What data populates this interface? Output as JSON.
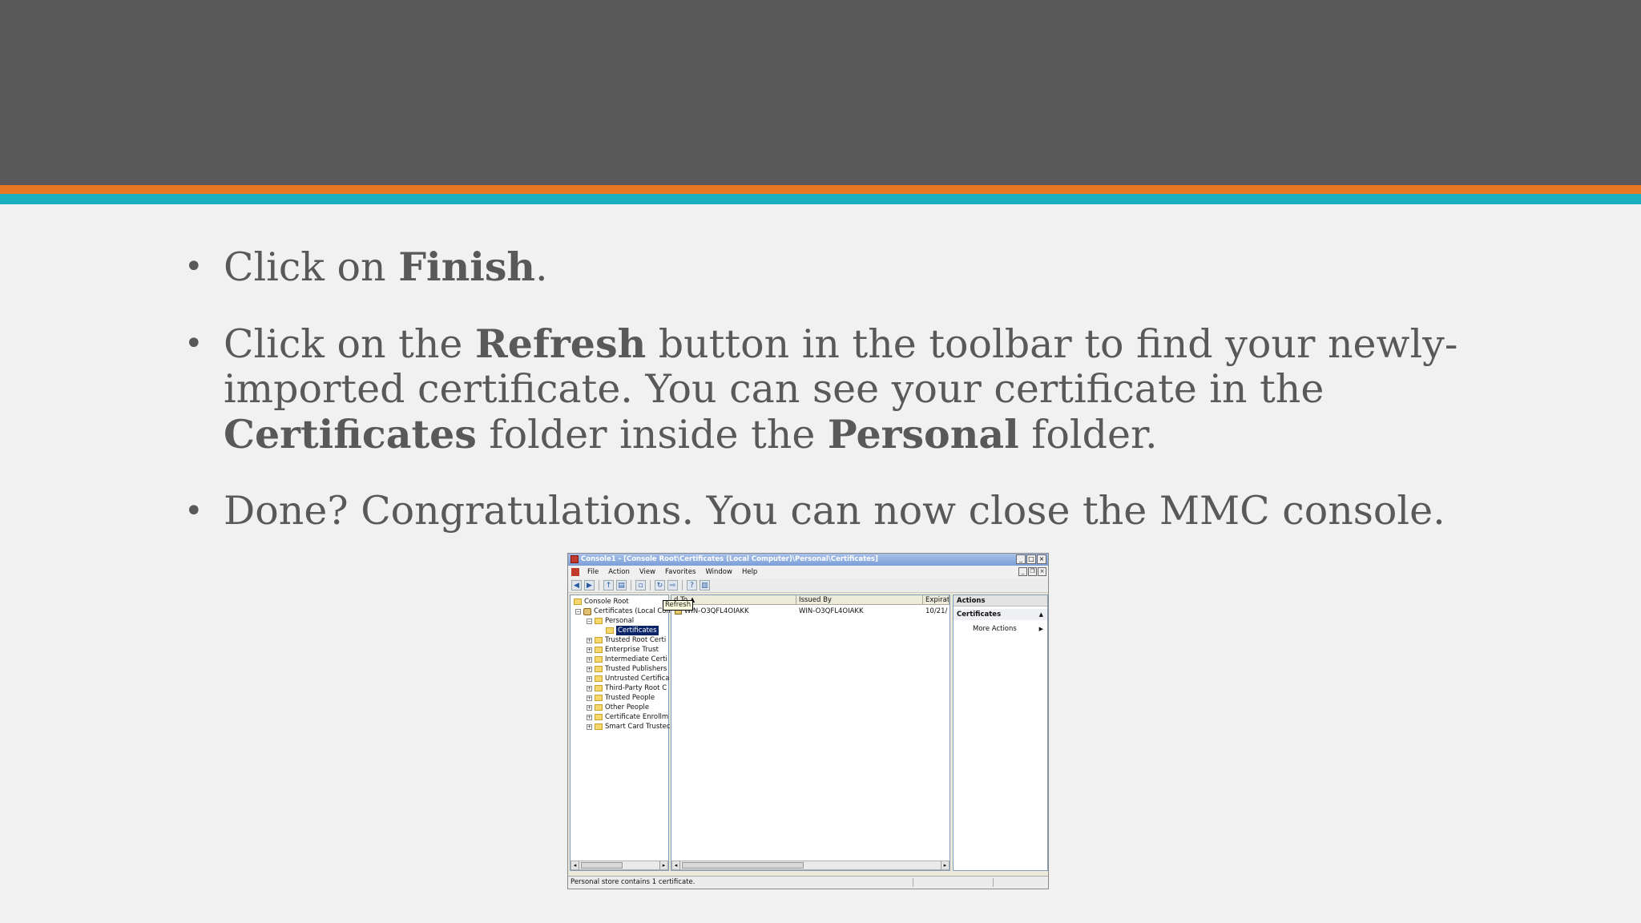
{
  "slide": {
    "colors": {
      "header": "#595959",
      "accent_orange": "#e87722",
      "accent_teal": "#1cafbf",
      "background": "#f2f1f2",
      "text": "#595959"
    },
    "bullets": [
      {
        "parts": [
          "Click on ",
          "Finish",
          "."
        ]
      },
      {
        "parts": [
          "Click on the ",
          "Refresh",
          " button in the toolbar to find your newly-imported certificate. You can see your certificate in the ",
          "Certificates",
          " folder inside the ",
          "Personal",
          " folder."
        ]
      },
      {
        "parts": [
          "Done? Congratulations. You can now close the MMC console."
        ]
      }
    ]
  },
  "mmc": {
    "title": "Console1 - [Console Root\\Certificates (Local Computer)\\Personal\\Certificates]",
    "menu": [
      "File",
      "Action",
      "View",
      "Favorites",
      "Window",
      "Help"
    ],
    "tooltip": "Refresh",
    "tree": {
      "root": "Console Root",
      "certs": "Certificates (Local Com",
      "personal": "Personal",
      "selected": "Certificates",
      "stores": [
        "Trusted Root Certi",
        "Enterprise Trust",
        "Intermediate Certi",
        "Trusted Publishers",
        "Untrusted Certifica",
        "Third-Party Root C",
        "Trusted People",
        "Other People",
        "Certificate Enrollm",
        "Smart Card Trustec"
      ]
    },
    "list": {
      "columns": [
        "Issued To",
        "Issued By",
        "Expirat"
      ],
      "header_visible": "d To",
      "row": {
        "issued_to": "WIN-O3QFL4OIAKK",
        "issued_by": "WIN-O3QFL4OIAKK",
        "expiration": "10/21/"
      }
    },
    "actions": {
      "header": "Actions",
      "section": "Certificates",
      "item": "More Actions"
    },
    "status": "Personal store contains 1 certificate."
  }
}
